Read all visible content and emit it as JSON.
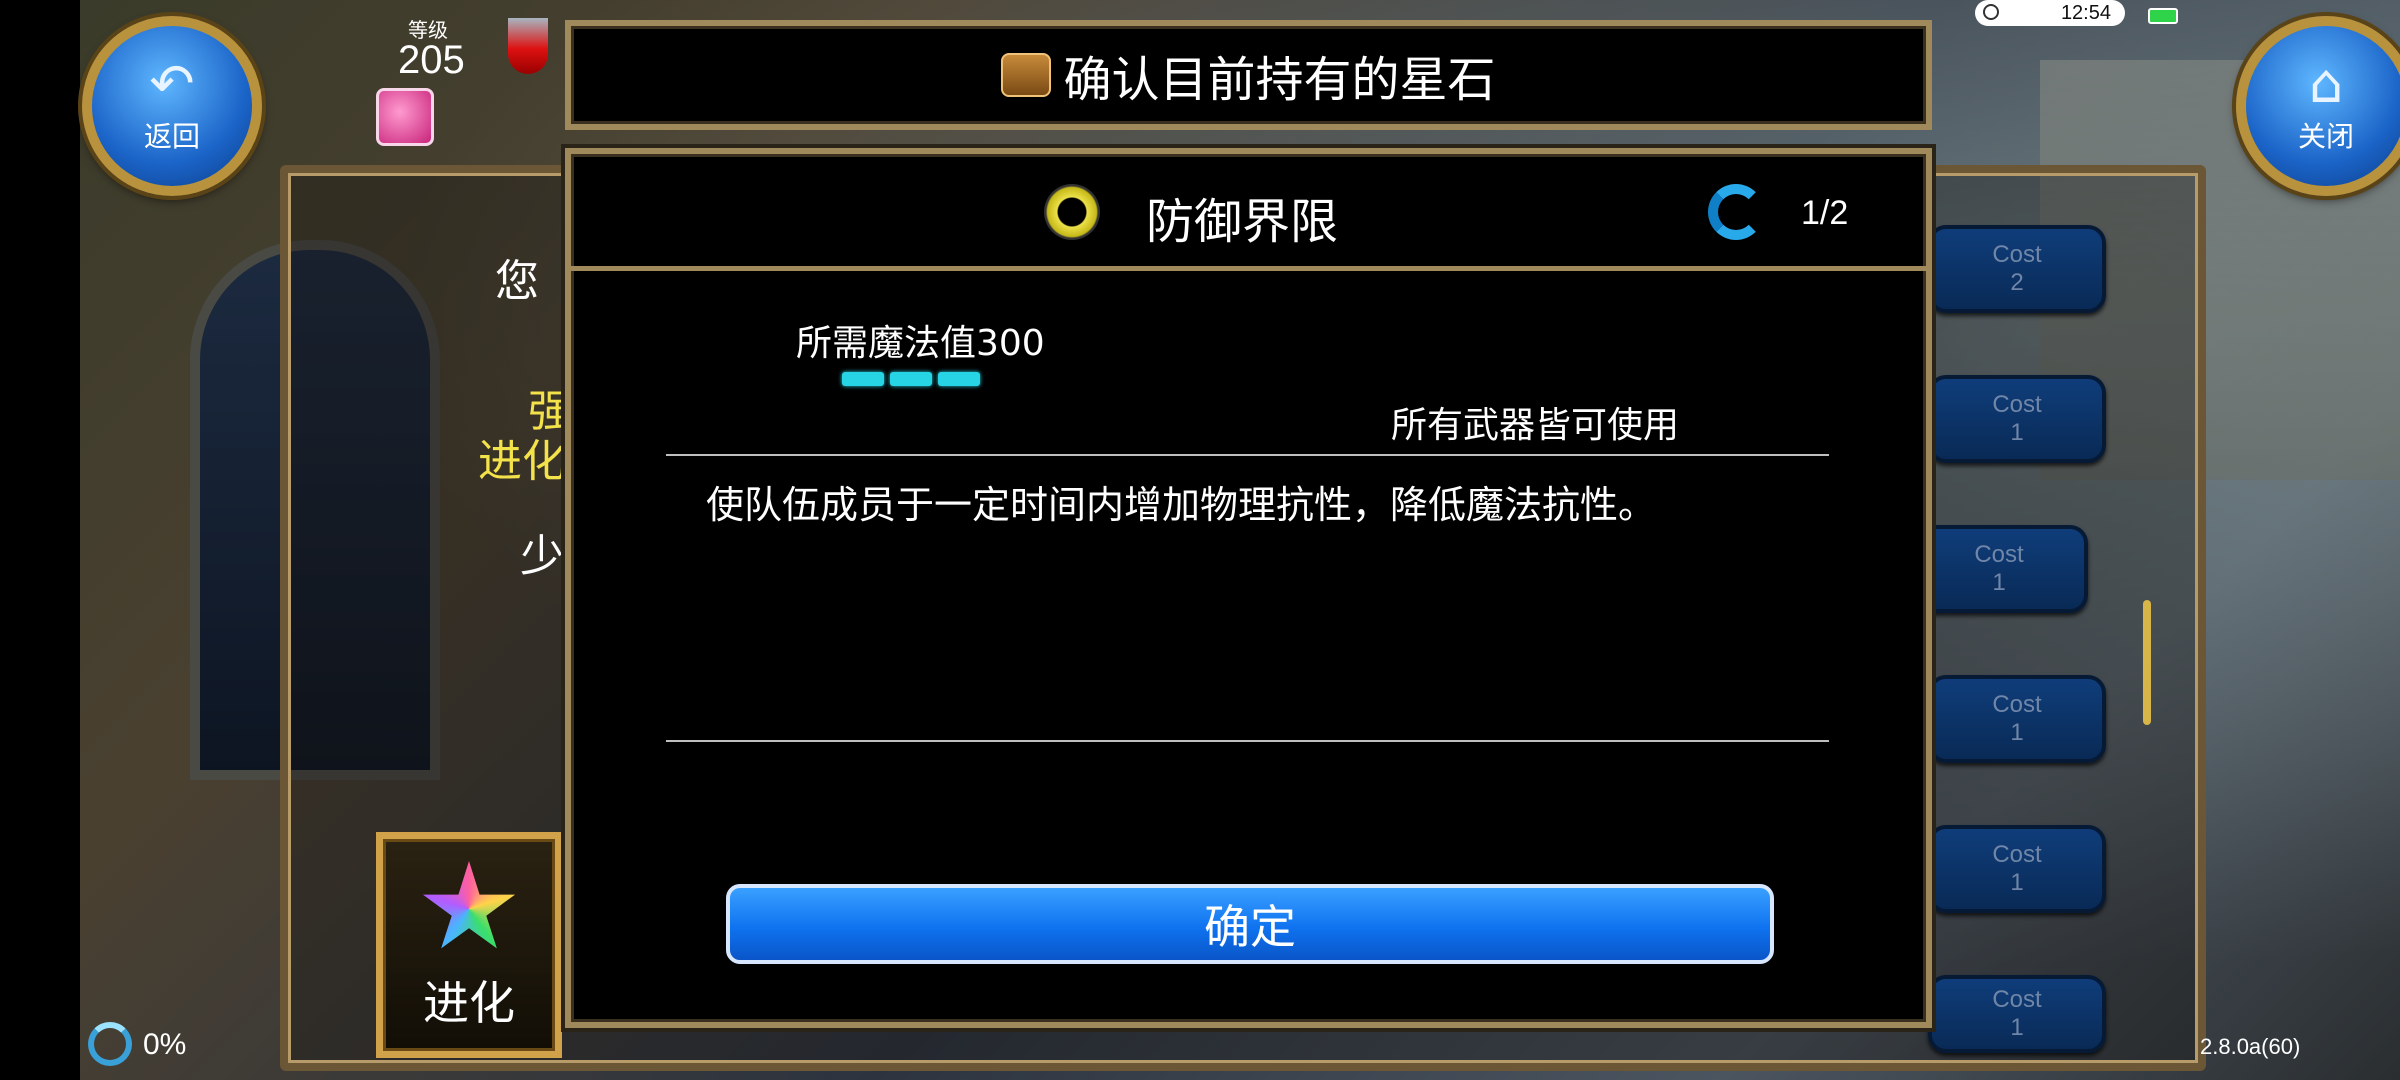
{
  "status_bar": {
    "time": "12:54"
  },
  "top_left": {
    "back_button": {
      "label": "返回",
      "icon": "back-arrow-icon"
    },
    "level_label": "等级",
    "level_value": "205"
  },
  "top_right": {
    "close_button": {
      "label": "关闭",
      "icon": "home-icon"
    }
  },
  "title_bar": {
    "title": "确认目前持有的星石",
    "icon": "bag-icon"
  },
  "background_panel": {
    "texts": [
      "您",
      "强",
      "进化",
      "少"
    ],
    "cost_buttons": [
      {
        "label": "Cost",
        "value": "2"
      },
      {
        "label": "Cost",
        "value": "1"
      },
      {
        "label": "Cost",
        "value": "1"
      },
      {
        "label": "Cost",
        "value": "1"
      },
      {
        "label": "Cost",
        "value": "1"
      },
      {
        "label": "Cost",
        "value": "1"
      }
    ],
    "evolve_button": {
      "label": "进化",
      "icon": "star-icon"
    }
  },
  "modal": {
    "skill_icon": "hexagon-shield-icon",
    "skill_name": "防御界限",
    "page_indicator": "1/2",
    "mp_required": "所需魔法值300",
    "mp_level": 3,
    "weapon_note": "所有武器皆可使用",
    "description": "使队伍成员于一定时间内增加物理抗性，降低魔法抗性。",
    "confirm_label": "确定"
  },
  "footer": {
    "loading_percent": "0%",
    "version": "2.8.0a(60)"
  },
  "colors": {
    "accent_blue": "#0f73f0",
    "mp_cyan": "#27d4e4",
    "frame_gold": "#a08a5c",
    "highlight_yellow": "#f3e24a"
  }
}
